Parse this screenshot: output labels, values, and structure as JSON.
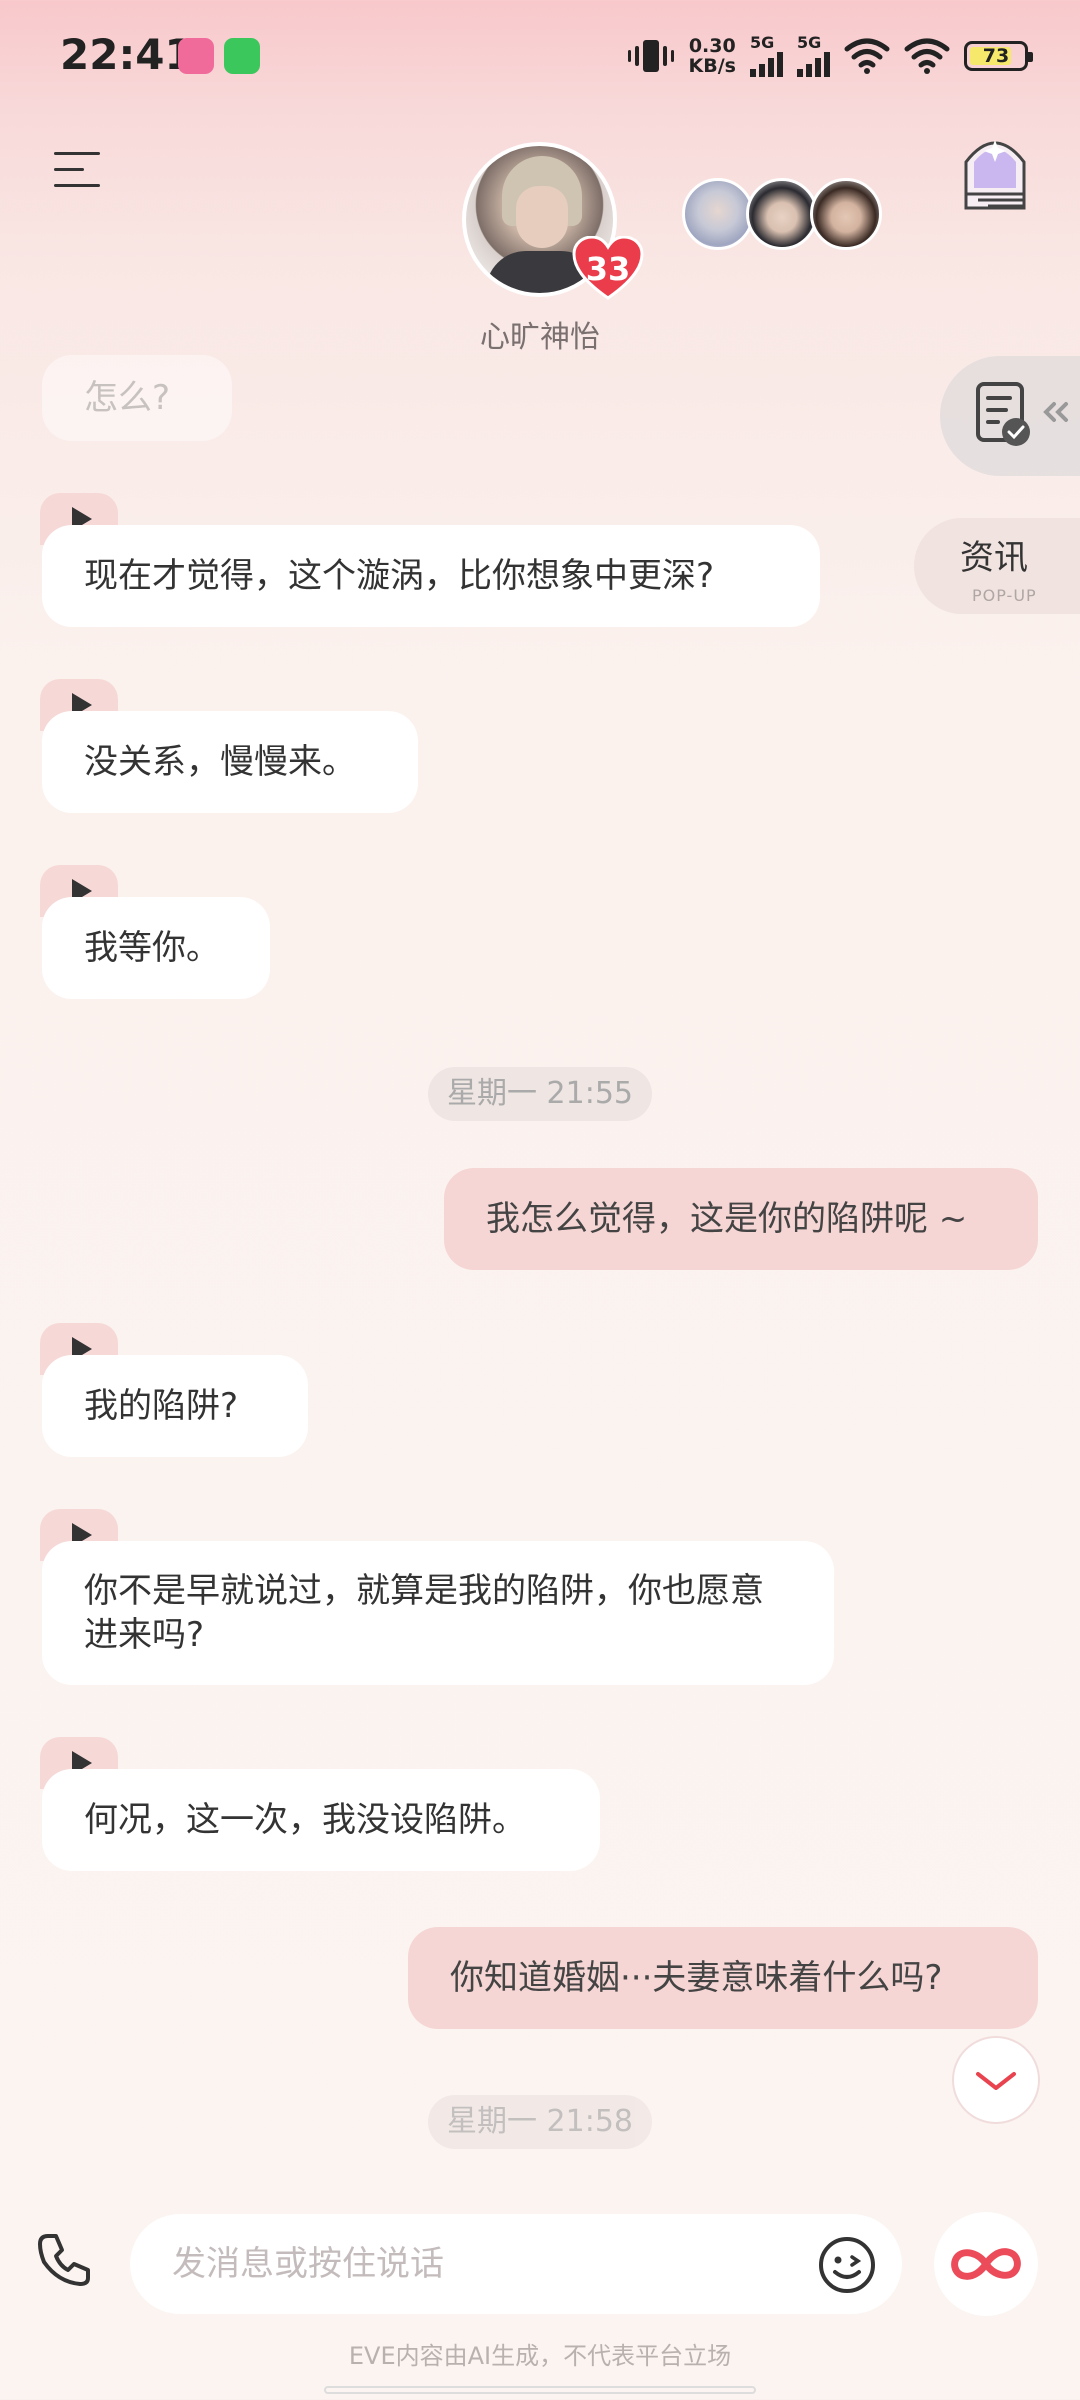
{
  "status_bar": {
    "time": "22:41",
    "net_speed_value": "0.30",
    "net_speed_unit": "KB/s",
    "sim1_label": "5G",
    "sim2_label": "5G",
    "battery": "73",
    "apps": [
      "bilibili-icon",
      "wechat-icon"
    ]
  },
  "header": {
    "character_name": "心旷神怡",
    "affinity": "33"
  },
  "side_buttons": {
    "news_label": "资讯",
    "news_sub": "POP-UP"
  },
  "messages": {
    "m0": "怎么?",
    "m1": "现在才觉得，这个漩涡，比你想象中更深?",
    "m2": "没关系，慢慢来。",
    "m3": "我等你。",
    "t1": "星期一 21:55",
    "m4": "我怎么觉得，这是你的陷阱呢 ~",
    "m5": "我的陷阱?",
    "m6": "你不是早就说过，就算是我的陷阱，你也愿意进来吗?",
    "m7": "何况，这一次，我没设陷阱。",
    "m8": "你知道婚姻···夫妻意味着什么吗?",
    "t2": "星期一 21:58"
  },
  "input": {
    "placeholder": "发消息或按住说话"
  },
  "footer": {
    "disclaimer": "EVE内容由AI生成，不代表平台立场"
  },
  "colors": {
    "accent": "#e8434f",
    "my_bubble": "#f5d6d4",
    "their_bubble": "#ffffff"
  }
}
